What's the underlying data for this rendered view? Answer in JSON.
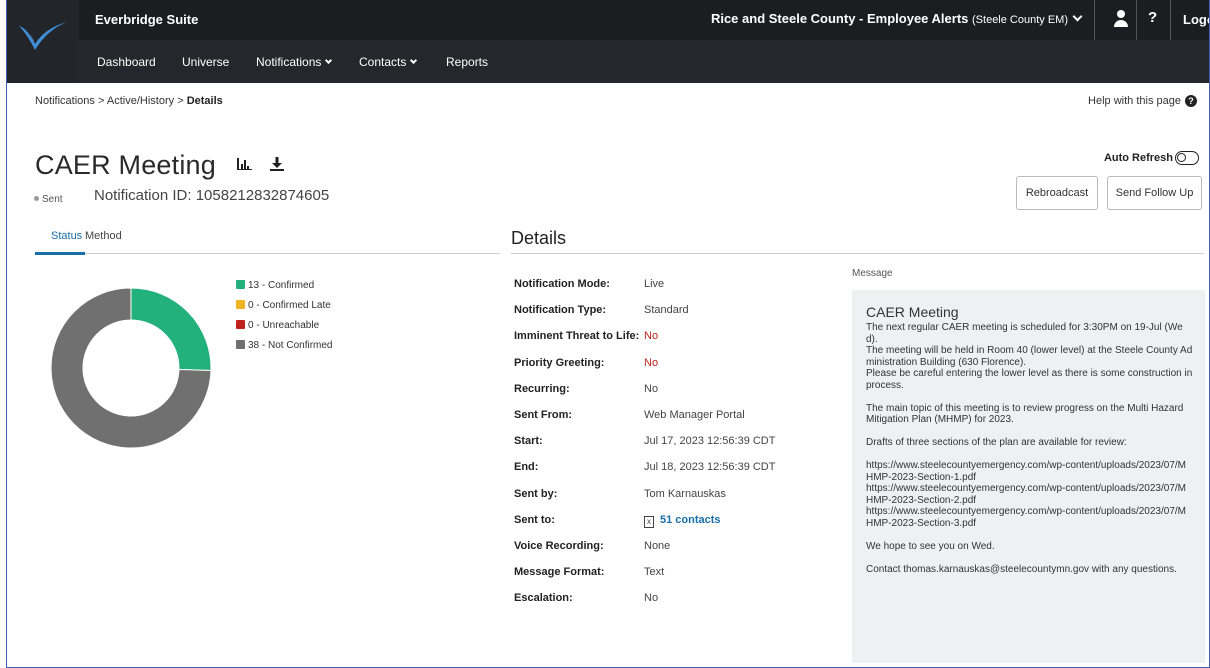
{
  "header": {
    "suite_title": "Everbridge Suite",
    "org_name": "Rice and Steele County - Employee Alerts",
    "org_sub": "(Steele County EM)",
    "help_label": "?",
    "logout_label": "Logo"
  },
  "nav": {
    "items": [
      {
        "label": "Dashboard"
      },
      {
        "label": "Universe"
      },
      {
        "label": "Notifications"
      },
      {
        "label": "Contacts"
      },
      {
        "label": "Reports"
      }
    ]
  },
  "breadcrumb": {
    "item1": "Notifications",
    "sep": ">",
    "item2": "Active/History",
    "item3": "Details"
  },
  "help_page": "Help with this page",
  "page": {
    "title": "CAER Meeting",
    "status": "Sent",
    "notification_id": "Notification ID: 1058212832874605",
    "auto_refresh": "Auto Refresh",
    "auto_refresh_on": false,
    "rebroadcast": "Rebroadcast",
    "send_follow_up": "Send Follow Up"
  },
  "tabs": {
    "status": "Status",
    "method": "Method",
    "active": "Status"
  },
  "details_title": "Details",
  "chart_data": {
    "type": "pie",
    "donut": true,
    "categories": [
      "Confirmed",
      "Confirmed Late",
      "Unreachable",
      "Not Confirmed"
    ],
    "values": [
      13,
      0,
      0,
      38
    ],
    "legend": [
      {
        "label": "13 - Confirmed",
        "color": "#22b07d"
      },
      {
        "label": "0 - Confirmed Late",
        "color": "#f0b323"
      },
      {
        "label": "0 - Unreachable",
        "color": "#c0211b"
      },
      {
        "label": "38 - Not Confirmed",
        "color": "#707070"
      }
    ],
    "legend_position": "right"
  },
  "details": [
    {
      "label": "Notification Mode:",
      "value": "Live"
    },
    {
      "label": "Notification Type:",
      "value": "Standard"
    },
    {
      "label": "Imminent Threat to Life:",
      "value": "No",
      "red": true
    },
    {
      "label": "Priority Greeting:",
      "value": "No",
      "red": true
    },
    {
      "label": "Recurring:",
      "value": "No"
    },
    {
      "label": "Sent From:",
      "value": "Web Manager Portal"
    },
    {
      "label": "Start:",
      "value": "Jul 17, 2023 12:56:39 CDT"
    },
    {
      "label": "End:",
      "value": "Jul 18, 2023 12:56:39 CDT"
    },
    {
      "label": "Sent by:",
      "value": "Tom Karnauskas"
    },
    {
      "label": "Sent to:",
      "value": "51 contacts",
      "link": true
    },
    {
      "label": "Voice Recording:",
      "value": "None"
    },
    {
      "label": "Message Format:",
      "value": "Text"
    },
    {
      "label": "Escalation:",
      "value": "No"
    }
  ],
  "message": {
    "label": "Message",
    "title": "CAER Meeting",
    "body": "The next regular CAER meeting is scheduled for 3:30PM on 19-Jul (Wed).\nThe meeting will be held in Room 40 (lower level) at the Steele County Administration Building (630 Florence).\nPlease be careful entering the lower level as there is some construction in process.\n\nThe main topic of this meeting is to review progress on the Multi Hazard Mitigation Plan (MHMP) for 2023.\n\nDrafts of three sections of the plan are available for review:\n\nhttps://www.steelecountyemergency.com/wp-content/uploads/2023/07/MHMP-2023-Section-1.pdf\nhttps://www.steelecountyemergency.com/wp-content/uploads/2023/07/MHMP-2023-Section-2.pdf\nhttps://www.steelecountyemergency.com/wp-content/uploads/2023/07/MHMP-2023-Section-3.pdf\n\nWe hope to see you on Wed.\n\nContact thomas.karnauskas@steelecountymn.gov with any questions."
  }
}
